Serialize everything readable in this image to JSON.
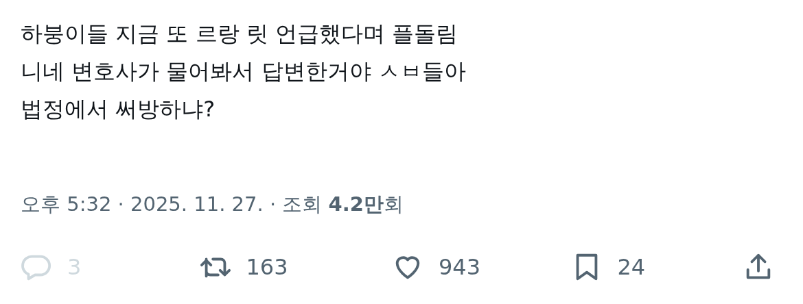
{
  "post": {
    "lines": [
      "하붕이들 지금 또 르랑 릿 언급했다며 플돌림",
      "니네 변호사가 물어봐서 답변한거야 ㅅㅂ들아",
      "법정에서 써방하냐?"
    ]
  },
  "meta": "오후 5:32 · 2025. 11. 27. · 조회 **4.2만**회",
  "actions": [
    {
      "kind": "reply",
      "count": "3",
      "disabled": true
    },
    {
      "kind": "repost",
      "count": "163",
      "disabled": false
    },
    {
      "kind": "like",
      "count": "943",
      "disabled": false
    },
    {
      "kind": "bookmark",
      "count": "24",
      "disabled": false
    },
    {
      "kind": "share",
      "disabled": false
    }
  ]
}
